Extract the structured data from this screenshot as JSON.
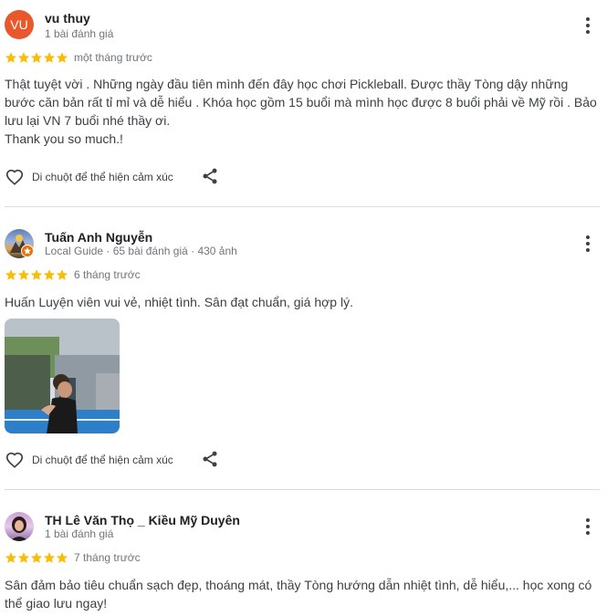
{
  "reviews": [
    {
      "avatar_letters": "VU",
      "avatar_color": "#e8582a",
      "name": "vu thuy",
      "meta": "1 bài đánh giá",
      "rating": 5,
      "time": "một tháng trước",
      "text_lines": [
        "Thật tuyệt vời . Những ngày đầu tiên mình đến đây học chơi Pickleball. Được thầy Tòng dậy những",
        "bước căn bản rất tỉ mỉ và dễ hiểu . Khóa học gồm 15 buổi mà mình học được 8 buổi phải về Mỹ rồi . Bảo",
        "lưu lại VN 7 buổi nhé thầy ơi.",
        "Thank you so much.!"
      ],
      "like_label": "Di chuột để thể hiện cảm xúc"
    },
    {
      "name": "Tuấn Anh Nguyễn",
      "meta": "Local Guide · 65 bài đánh giá · 430 ảnh",
      "rating": 5,
      "time": "6 tháng trước",
      "text_lines": [
        "Huấn Luyện viên vui vẻ, nhiệt tình. Sân đạt chuẩn, giá hợp lý."
      ],
      "like_label": "Di chuột để thể hiện cảm xúc"
    },
    {
      "name": "TH Lê Văn Thọ _ Kiều Mỹ Duyên",
      "meta": "1 bài đánh giá",
      "rating": 5,
      "time": "7 tháng trước",
      "text_lines": [
        "Sân đảm bảo tiêu chuẩn sạch đẹp, thoáng mát, thầy Tòng hướng dẫn nhiệt tình, dễ hiểu,... học xong có",
        "thể giao lưu ngay!"
      ]
    }
  ],
  "colors": {
    "star": "#fbbc04",
    "divider": "#dadce0",
    "badge": "#e8710a"
  },
  "icons": [
    "more-vert-icon",
    "heart-outline-icon",
    "share-icon",
    "star-icon",
    "local-guide-badge-icon"
  ]
}
